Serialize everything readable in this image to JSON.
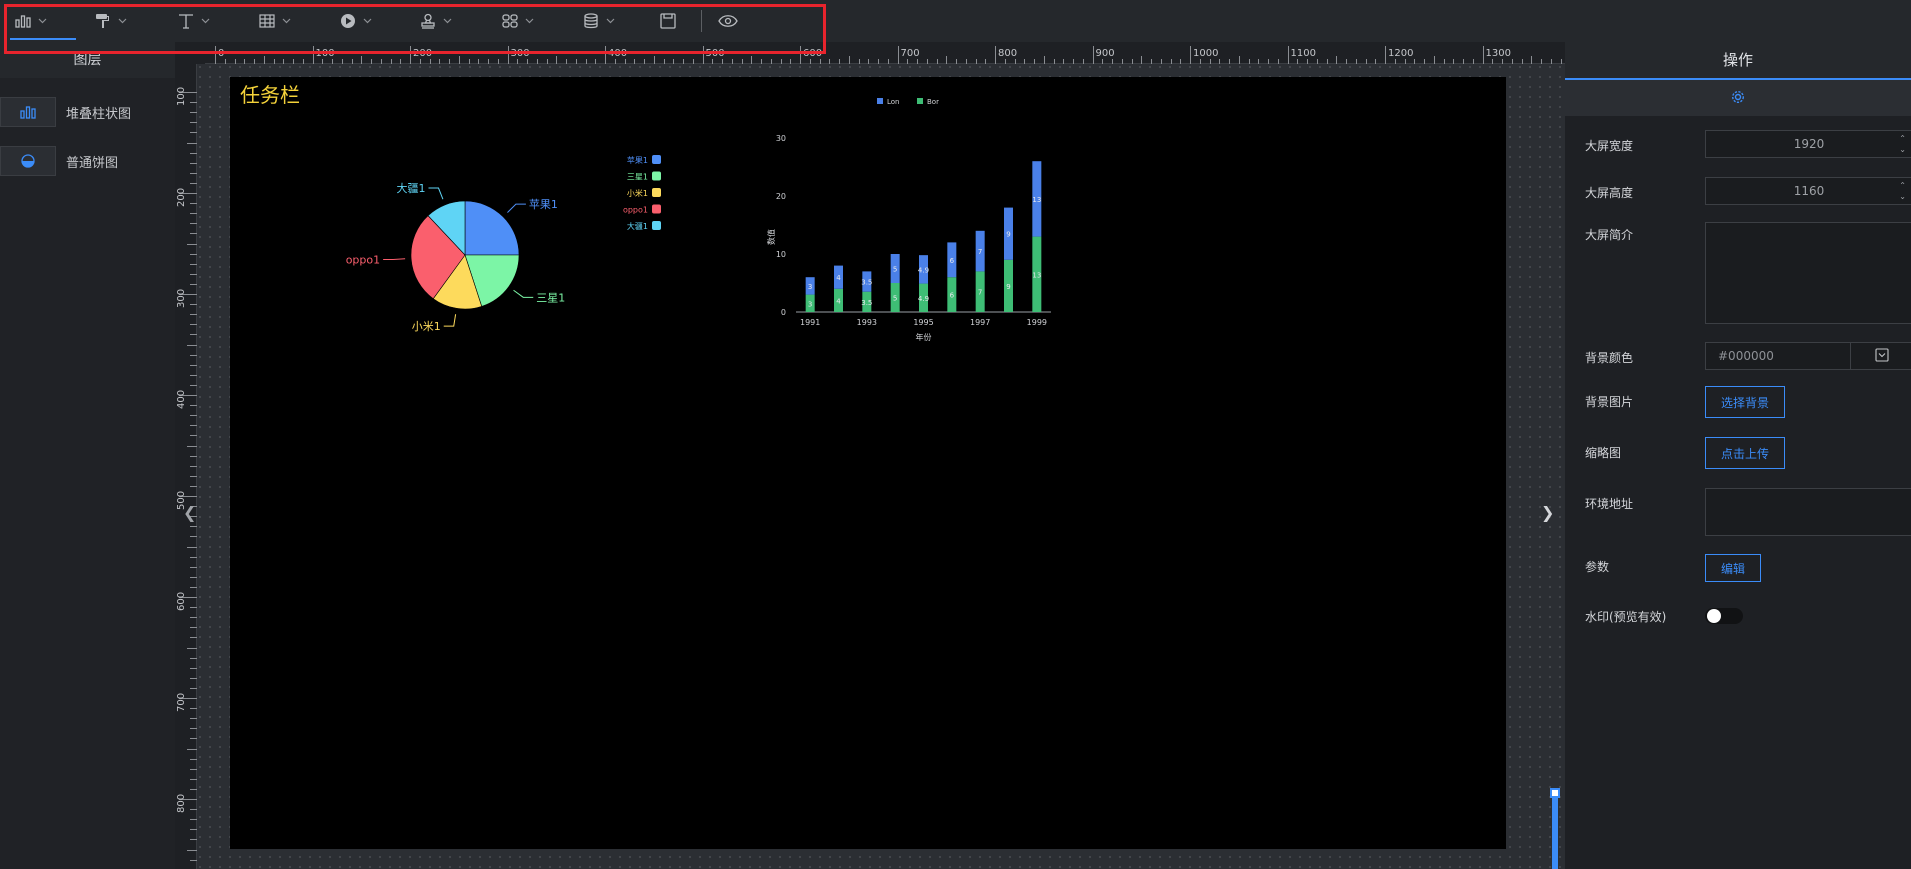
{
  "toolbar": {
    "items": [
      {
        "icon": "bar-chart-icon"
      },
      {
        "icon": "paint-roller-icon"
      },
      {
        "icon": "text-icon"
      },
      {
        "icon": "table-icon"
      },
      {
        "icon": "media-play-icon"
      },
      {
        "icon": "stamp-icon"
      },
      {
        "icon": "grid-icon"
      },
      {
        "icon": "database-icon"
      },
      {
        "icon": "save-icon"
      },
      {
        "icon": "eye-icon"
      }
    ],
    "highlight_color": "#e8242d",
    "active_color": "#3b8cf8"
  },
  "layers": {
    "title": "图层",
    "items": [
      {
        "label": "堆叠柱状图",
        "icon": "bar-chart-icon"
      },
      {
        "label": "普通饼图",
        "icon": "pie-chart-icon"
      }
    ]
  },
  "ruler": {
    "top_labels": [
      "0",
      "100",
      "200",
      "300",
      "400",
      "500",
      "600",
      "700",
      "800",
      "900",
      "1000",
      "1100",
      "1200",
      "1300"
    ],
    "left_labels": [
      "100",
      "200",
      "300",
      "400",
      "500",
      "600",
      "700",
      "800"
    ]
  },
  "screen": {
    "title": "任务栏",
    "background": "#000000",
    "title_color": "#f5d33a"
  },
  "chart_data": [
    {
      "type": "pie",
      "labels": [
        "苹果1",
        "三星1",
        "小米1",
        "oppo1",
        "大疆1"
      ],
      "values": [
        25,
        20,
        15,
        28,
        12
      ],
      "colors": [
        "#4f8ff7",
        "#7cf5a6",
        "#fdda5c",
        "#fa5f6d",
        "#5fd4f5"
      ],
      "legend": [
        "苹果1",
        "三星1",
        "小米1",
        "oppo1",
        "大疆1"
      ],
      "legend_position": "right"
    },
    {
      "type": "bar",
      "stacked": true,
      "categories": [
        "1991",
        "1992",
        "1993",
        "1994",
        "1995",
        "1996",
        "1997",
        "1998",
        "1999"
      ],
      "x_tick_labels": [
        "1991",
        "1993",
        "1995",
        "1997",
        "1999"
      ],
      "series": [
        {
          "name": "Bor",
          "values": [
            3,
            4,
            3.5,
            5,
            4.9,
            6,
            7,
            9,
            13
          ],
          "color": "#3ebd75"
        },
        {
          "name": "Lon",
          "values": [
            3,
            4,
            3.5,
            5,
            4.9,
            6,
            7,
            9,
            13
          ],
          "color": "#4a80e8"
        }
      ],
      "legend": [
        "Lon",
        "Bor"
      ],
      "xlabel": "年份",
      "ylabel": "数值",
      "ylim": [
        0,
        30
      ],
      "yticks": [
        0,
        10,
        20,
        30
      ]
    }
  ],
  "properties": {
    "title": "操作",
    "settings_icon": "gear-icon",
    "fields": {
      "width_label": "大屏宽度",
      "width_value": "1920",
      "height_label": "大屏高度",
      "height_value": "1160",
      "intro_label": "大屏简介",
      "bg_color_label": "背景颜色",
      "bg_color_value": "#000000",
      "bg_image_label": "背景图片",
      "bg_image_button": "选择背景",
      "thumb_label": "缩略图",
      "thumb_button": "点击上传",
      "env_label": "环境地址",
      "params_label": "参数",
      "params_button": "编辑",
      "watermark_label": "水印(预览有效)"
    }
  }
}
